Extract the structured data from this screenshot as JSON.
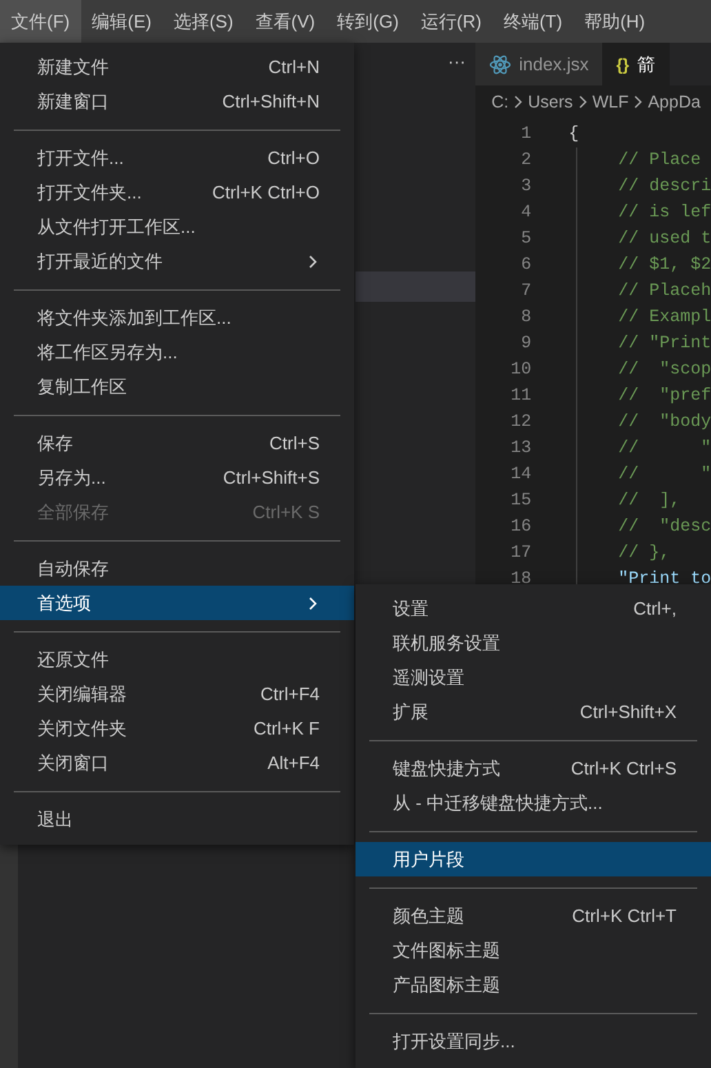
{
  "menubar": [
    {
      "label": "文件(F)",
      "selected": true
    },
    {
      "label": "编辑(E)",
      "selected": false
    },
    {
      "label": "选择(S)",
      "selected": false
    },
    {
      "label": "查看(V)",
      "selected": false
    },
    {
      "label": "转到(G)",
      "selected": false
    },
    {
      "label": "运行(R)",
      "selected": false
    },
    {
      "label": "终端(T)",
      "selected": false
    },
    {
      "label": "帮助(H)",
      "selected": false
    }
  ],
  "editor": {
    "overflow_button": "···",
    "tabs": [
      {
        "kind": "react",
        "label": "index.jsx",
        "selected": false
      },
      {
        "kind": "glyph",
        "glyph": "{}",
        "label": "箭",
        "selected": true
      }
    ],
    "breadcrumb": [
      "C:",
      "Users",
      "WLF",
      "AppDa"
    ],
    "code_lines": [
      {
        "number": "1",
        "kind": "brace",
        "text": "{"
      },
      {
        "number": "2",
        "kind": "comment",
        "text": "// Place"
      },
      {
        "number": "3",
        "kind": "comment",
        "text": "// descri"
      },
      {
        "number": "4",
        "kind": "comment",
        "text": "// is lef"
      },
      {
        "number": "5",
        "kind": "comment",
        "text": "// used t"
      },
      {
        "number": "6",
        "kind": "comment",
        "text": "// $1, $2"
      },
      {
        "number": "7",
        "kind": "comment",
        "text": "// Placeh"
      },
      {
        "number": "8",
        "kind": "comment",
        "text": "// Exampl"
      },
      {
        "number": "9",
        "kind": "comment",
        "text": "// \"Print"
      },
      {
        "number": "10",
        "kind": "comment",
        "text": "//  \"scop"
      },
      {
        "number": "11",
        "kind": "comment",
        "text": "//  \"pref"
      },
      {
        "number": "12",
        "kind": "comment",
        "text": "//  \"body"
      },
      {
        "number": "13",
        "kind": "comment",
        "text": "//      \""
      },
      {
        "number": "14",
        "kind": "comment",
        "text": "//      \""
      },
      {
        "number": "15",
        "kind": "comment",
        "text": "//  ],"
      },
      {
        "number": "16",
        "kind": "comment",
        "text": "//  \"desc"
      },
      {
        "number": "17",
        "kind": "comment",
        "text": "// },"
      },
      {
        "number": "18",
        "kind": "string",
        "text": "\"Print to"
      }
    ]
  },
  "file_menu": [
    {
      "kind": "item",
      "label": "新建文件",
      "shortcut": "Ctrl+N",
      "disabled": false,
      "selected": false
    },
    {
      "kind": "item",
      "label": "新建窗口",
      "shortcut": "Ctrl+Shift+N",
      "disabled": false,
      "selected": false
    },
    {
      "kind": "separator"
    },
    {
      "kind": "item",
      "label": "打开文件...",
      "shortcut": "Ctrl+O",
      "disabled": false,
      "selected": false
    },
    {
      "kind": "item",
      "label": "打开文件夹...",
      "shortcut": "Ctrl+K Ctrl+O",
      "disabled": false,
      "selected": false
    },
    {
      "kind": "item",
      "label": "从文件打开工作区...",
      "disabled": false,
      "selected": false
    },
    {
      "kind": "submenu",
      "label": "打开最近的文件",
      "disabled": false,
      "selected": false
    },
    {
      "kind": "separator"
    },
    {
      "kind": "item",
      "label": "将文件夹添加到工作区...",
      "disabled": false,
      "selected": false
    },
    {
      "kind": "item",
      "label": "将工作区另存为...",
      "disabled": false,
      "selected": false
    },
    {
      "kind": "item",
      "label": "复制工作区",
      "disabled": false,
      "selected": false
    },
    {
      "kind": "separator"
    },
    {
      "kind": "item",
      "label": "保存",
      "shortcut": "Ctrl+S",
      "disabled": false,
      "selected": false
    },
    {
      "kind": "item",
      "label": "另存为...",
      "shortcut": "Ctrl+Shift+S",
      "disabled": false,
      "selected": false
    },
    {
      "kind": "item",
      "label": "全部保存",
      "shortcut": "Ctrl+K S",
      "disabled": true,
      "selected": false
    },
    {
      "kind": "separator"
    },
    {
      "kind": "item",
      "label": "自动保存",
      "disabled": false,
      "selected": false
    },
    {
      "kind": "submenu",
      "label": "首选项",
      "disabled": false,
      "selected": true
    },
    {
      "kind": "separator"
    },
    {
      "kind": "item",
      "label": "还原文件",
      "disabled": false,
      "selected": false
    },
    {
      "kind": "item",
      "label": "关闭编辑器",
      "shortcut": "Ctrl+F4",
      "disabled": false,
      "selected": false
    },
    {
      "kind": "item",
      "label": "关闭文件夹",
      "shortcut": "Ctrl+K F",
      "disabled": false,
      "selected": false
    },
    {
      "kind": "item",
      "label": "关闭窗口",
      "shortcut": "Alt+F4",
      "disabled": false,
      "selected": false
    },
    {
      "kind": "separator"
    },
    {
      "kind": "item",
      "label": "退出",
      "disabled": false,
      "selected": false
    }
  ],
  "preferences_submenu": [
    {
      "kind": "item",
      "label": "设置",
      "shortcut": "Ctrl+,",
      "disabled": false,
      "selected": false
    },
    {
      "kind": "item",
      "label": "联机服务设置",
      "disabled": false,
      "selected": false
    },
    {
      "kind": "item",
      "label": "遥测设置",
      "disabled": false,
      "selected": false
    },
    {
      "kind": "item",
      "label": "扩展",
      "shortcut": "Ctrl+Shift+X",
      "disabled": false,
      "selected": false
    },
    {
      "kind": "separator"
    },
    {
      "kind": "item",
      "label": "键盘快捷方式",
      "shortcut": "Ctrl+K Ctrl+S",
      "disabled": false,
      "selected": false
    },
    {
      "kind": "item",
      "label": "从 - 中迁移键盘快捷方式...",
      "disabled": false,
      "selected": false
    },
    {
      "kind": "separator"
    },
    {
      "kind": "item",
      "label": "用户片段",
      "disabled": false,
      "selected": true
    },
    {
      "kind": "separator"
    },
    {
      "kind": "item",
      "label": "颜色主题",
      "shortcut": "Ctrl+K Ctrl+T",
      "disabled": false,
      "selected": false
    },
    {
      "kind": "item",
      "label": "文件图标主题",
      "disabled": false,
      "selected": false
    },
    {
      "kind": "item",
      "label": "产品图标主题",
      "disabled": false,
      "selected": false
    },
    {
      "kind": "separator"
    },
    {
      "kind": "item",
      "label": "打开设置同步...",
      "disabled": false,
      "selected": false
    }
  ]
}
